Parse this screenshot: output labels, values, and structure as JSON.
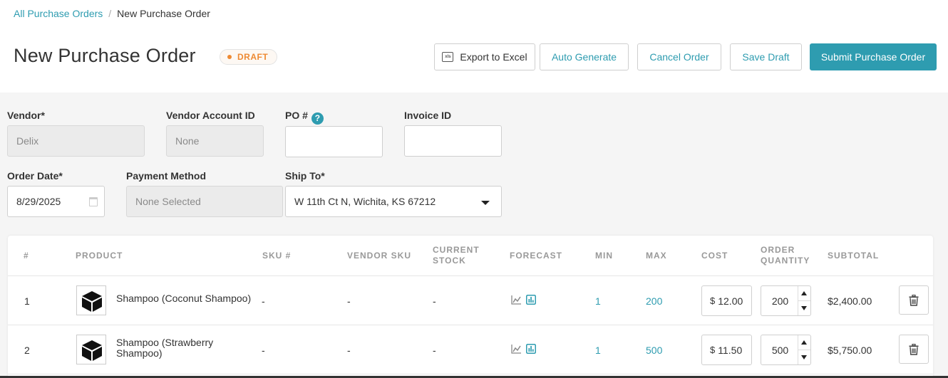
{
  "breadcrumb": {
    "parent": "All Purchase Orders",
    "separator": "/",
    "current": "New Purchase Order"
  },
  "title": "New Purchase Order",
  "status": "DRAFT",
  "colors": {
    "accent": "#2e9cb0",
    "draft": "#ee8a33"
  },
  "actions": {
    "export": "Export to Excel",
    "export_icon": "xls",
    "auto_generate": "Auto Generate",
    "cancel": "Cancel Order",
    "save_draft": "Save Draft",
    "submit": "Submit Purchase Order"
  },
  "form": {
    "vendor": {
      "label": "Vendor*",
      "value": "Delix"
    },
    "vendor_account_id": {
      "label": "Vendor Account ID",
      "value": "None"
    },
    "po_number": {
      "label": "PO #",
      "help": "?",
      "value": ""
    },
    "invoice_id": {
      "label": "Invoice ID",
      "value": ""
    },
    "order_date": {
      "label": "Order Date*",
      "value": "8/29/2025"
    },
    "payment_method": {
      "label": "Payment Method",
      "value": "None Selected"
    },
    "ship_to": {
      "label": "Ship To*",
      "value": "W 11th Ct N, Wichita, KS 67212"
    }
  },
  "table": {
    "columns": {
      "num": "#",
      "product": "PRODUCT",
      "sku": "SKU #",
      "vendor_sku": "VENDOR SKU",
      "current_stock": "CURRENT STOCK",
      "forecast": "FORECAST",
      "min": "MIN",
      "max": "MAX",
      "cost": "COST",
      "order_quantity": "ORDER QUANTITY",
      "subtotal": "SUBTOTAL"
    },
    "rows": [
      {
        "num": "1",
        "product": "Shampoo (Coconut Shampoo)",
        "sku": "-",
        "vendor_sku": "-",
        "current_stock": "-",
        "min": "1",
        "max": "200",
        "currency": "$",
        "cost": "12.00",
        "quantity": "200",
        "subtotal": "$2,400.00"
      },
      {
        "num": "2",
        "product": "Shampoo (Strawberry Shampoo)",
        "sku": "-",
        "vendor_sku": "-",
        "current_stock": "-",
        "min": "1",
        "max": "500",
        "currency": "$",
        "cost": "11.50",
        "quantity": "500",
        "subtotal": "$5,750.00"
      }
    ]
  }
}
